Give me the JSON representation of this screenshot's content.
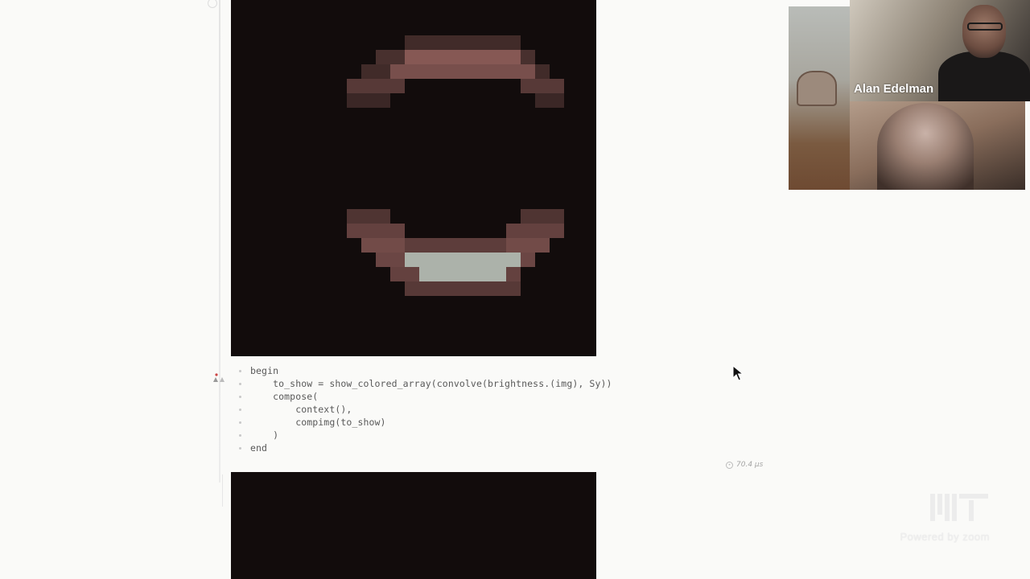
{
  "video": {
    "speaker_name": "Alan Edelman"
  },
  "code_cell": {
    "lines": [
      "begin",
      "    to_show = show_colored_array(convolve(brightness.(img), Sy))",
      "    compose(",
      "        context(),",
      "        compimg(to_show)",
      "    )",
      "end"
    ]
  },
  "runtime": {
    "text": "70.4 μs"
  },
  "watermark": {
    "logo_text": "MIT",
    "caption": "Powered by zoom"
  },
  "colors": {
    "plot_background": "#120c0c",
    "pixel_red": "#9b6662",
    "pixel_pale": "#b5bcb3",
    "code_text": "#595959"
  },
  "icons": [
    "cell-pin-icon",
    "clock-icon",
    "mouse-cursor-icon",
    "mit-logo-icon"
  ]
}
